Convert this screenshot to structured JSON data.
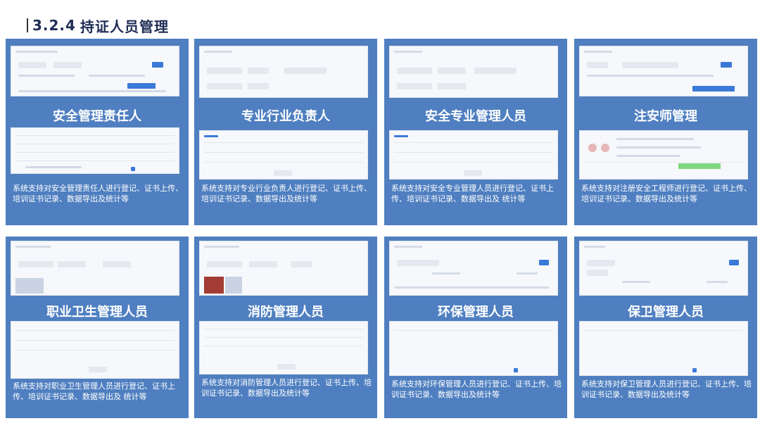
{
  "section": {
    "number": "3.2.4",
    "title": "持证人员管理"
  },
  "cards": [
    {
      "title": "安全管理责任人",
      "desc": "系统支持对安全管理责任人进行登记、证书上传、培训证书记录、数据导出及统计等"
    },
    {
      "title": "专业行业负责人",
      "desc": "系统支持对专业行业负责人进行登记、证书上传、培训证书记录、数据导出及统计等"
    },
    {
      "title": "安全专业管理人员",
      "desc": "系统支持对安全专业管理人员进行登记、证书上传、培训证书记录、数据导出及 统计等"
    },
    {
      "title": "注安师管理",
      "desc": "系统支持对注册安全工程师进行登记、证书上传、培训证书记录、数据导出及统计等"
    },
    {
      "title": "职业卫生管理人员",
      "desc": "系统支持对职业卫生管理人员进行登记、证书上传、培训证书记录、数据导出及 统计等"
    },
    {
      "title": "消防管理人员",
      "desc": "系统支持对消防管理人员进行登记、证书上传、培训证书记录、数据导出及统计等"
    },
    {
      "title": "环保管理人员",
      "desc": "系统支持对环保管理人员进行登记、证书上传、培训证书记录、数据导出及统计等"
    },
    {
      "title": "保卫管理人员",
      "desc": "系统支持对保卫管理人员进行登记、证书上传、培训证书记录、数据导出及统计等"
    }
  ],
  "colors": {
    "card_bg": "#4f7fc0",
    "heading": "#1f2d55",
    "accent": "#3b79d8"
  }
}
